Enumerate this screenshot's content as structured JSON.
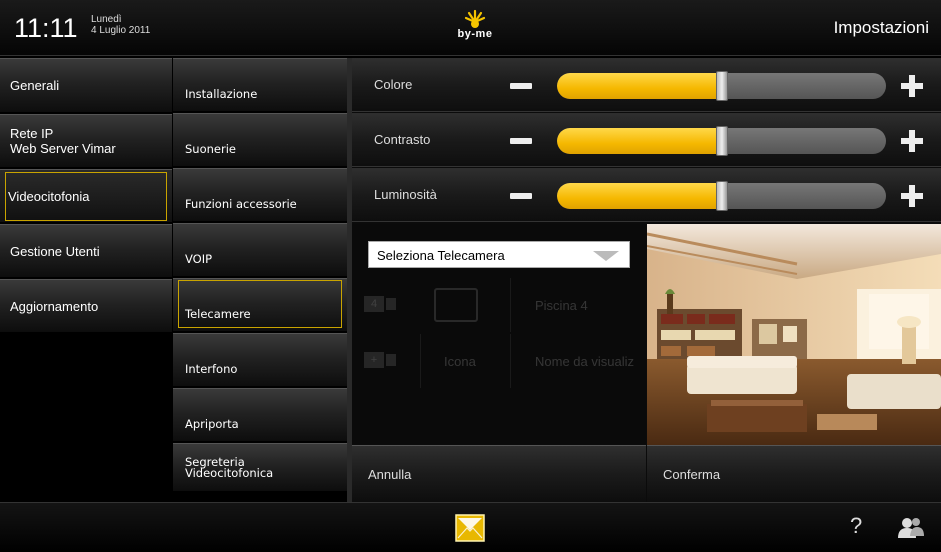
{
  "header": {
    "time": "11:11",
    "day": "Lunedì",
    "date": "4 Luglio 2011",
    "brand": "by-me",
    "title": "Impostazioni"
  },
  "menu_primary": [
    {
      "label": "Generali"
    },
    {
      "label_line1": "Rete IP",
      "label_line2": "Web Server Vimar"
    },
    {
      "label": "Videocitofonia",
      "selected": true
    },
    {
      "label": "Gestione Utenti"
    },
    {
      "label": "Aggiornamento"
    }
  ],
  "menu_secondary": [
    {
      "label": "Installazione"
    },
    {
      "label": "Suonerie"
    },
    {
      "label": "Funzioni accessorie"
    },
    {
      "label": "VOIP"
    },
    {
      "label": "Telecamere",
      "selected": true
    },
    {
      "label": "Interfono"
    },
    {
      "label": "Apriporta"
    },
    {
      "label_line1": "Segreteria",
      "label_line2": "Videocitofonica"
    }
  ],
  "sliders": [
    {
      "label": "Colore",
      "level": 0.5
    },
    {
      "label": "Contrasto",
      "level": 0.5
    },
    {
      "label": "Luminosità",
      "level": 0.5
    }
  ],
  "camera": {
    "dropdown_value": "Seleziona Telecamera",
    "row1": {
      "badge": "4",
      "name": "Piscina 4"
    },
    "row2": {
      "badge": "+",
      "icon_label": "Icona",
      "name_label": "Nome da visualiz"
    }
  },
  "actions": {
    "cancel": "Annulla",
    "confirm": "Conferma"
  },
  "footer": {
    "help": "?"
  },
  "colors": {
    "accent": "#f5b800",
    "selected_outline": "#c9a400"
  }
}
